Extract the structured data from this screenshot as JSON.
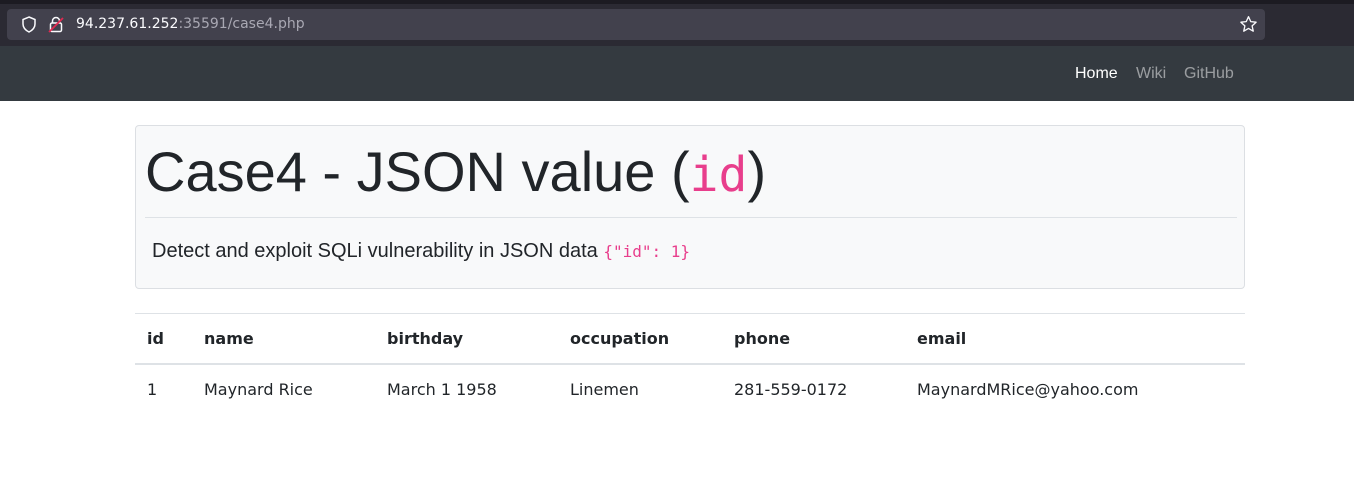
{
  "browser": {
    "url_host": "94.237.61.252",
    "url_rest": ":35591/case4.php"
  },
  "navbar": {
    "links": [
      {
        "label": "Home",
        "active": true
      },
      {
        "label": "Wiki",
        "active": false
      },
      {
        "label": "GitHub",
        "active": false
      }
    ]
  },
  "jumbotron": {
    "title_prefix": "Case4 - JSON value (",
    "title_code": "id",
    "title_suffix": ")",
    "lead_text": "Detect and exploit SQLi vulnerability in JSON data ",
    "lead_code": "{\"id\": 1}"
  },
  "table": {
    "headers": [
      "id",
      "name",
      "birthday",
      "occupation",
      "phone",
      "email"
    ],
    "rows": [
      [
        "1",
        "Maynard Rice",
        "March 1 1958",
        "Linemen",
        "281-559-0172",
        "MaynardMRice@yahoo.com"
      ]
    ]
  },
  "colors": {
    "navbar_bg": "#343a40",
    "code_accent": "#e83e8c",
    "browser_bg": "#2b2a33"
  }
}
